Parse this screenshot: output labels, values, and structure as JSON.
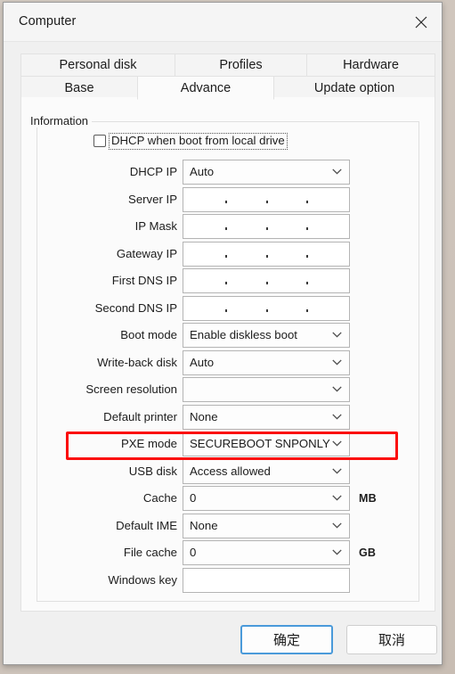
{
  "window": {
    "title": "Computer",
    "close_icon": "close-icon"
  },
  "tabs": {
    "row1": [
      {
        "label": "Personal disk",
        "selected": false
      },
      {
        "label": "Profiles",
        "selected": false
      },
      {
        "label": "Hardware",
        "selected": false
      }
    ],
    "row2": [
      {
        "label": "Base",
        "selected": false
      },
      {
        "label": "Advance",
        "selected": true
      },
      {
        "label": "Update option",
        "selected": false
      }
    ]
  },
  "group": {
    "legend": "Information"
  },
  "checkbox": {
    "label": "DHCP when boot from local drive",
    "checked": false
  },
  "fields": [
    {
      "label": "DHCP IP",
      "type": "combo",
      "value": "Auto",
      "unit": ""
    },
    {
      "label": "Server IP",
      "type": "ip",
      "value": "",
      "unit": ""
    },
    {
      "label": "IP Mask",
      "type": "ip",
      "value": "",
      "unit": ""
    },
    {
      "label": "Gateway IP",
      "type": "ip",
      "value": "",
      "unit": ""
    },
    {
      "label": "First DNS IP",
      "type": "ip",
      "value": "",
      "unit": ""
    },
    {
      "label": "Second DNS IP",
      "type": "ip",
      "value": "",
      "unit": ""
    },
    {
      "label": "Boot mode",
      "type": "combo",
      "value": "Enable diskless boot",
      "unit": ""
    },
    {
      "label": "Write-back disk",
      "type": "combo",
      "value": "Auto",
      "unit": ""
    },
    {
      "label": "Screen resolution",
      "type": "combo",
      "value": "",
      "unit": ""
    },
    {
      "label": "Default printer",
      "type": "combo",
      "value": "None",
      "unit": ""
    },
    {
      "label": "PXE mode",
      "type": "combo",
      "value": "SECUREBOOT SNPONLY",
      "unit": "",
      "highlighted": true
    },
    {
      "label": "USB disk",
      "type": "combo",
      "value": "Access allowed",
      "unit": ""
    },
    {
      "label": "Cache",
      "type": "combo",
      "value": "0",
      "unit": "MB"
    },
    {
      "label": "Default IME",
      "type": "combo",
      "value": "None",
      "unit": ""
    },
    {
      "label": "File cache",
      "type": "combo",
      "value": "0",
      "unit": "GB"
    },
    {
      "label": "Windows key",
      "type": "text",
      "value": "",
      "unit": ""
    }
  ],
  "footer": {
    "ok_label": "确定",
    "cancel_label": "取消"
  },
  "colors": {
    "highlight": "#fb0d0d",
    "focus_border": "#4a9ada",
    "dialog_bg": "#f0f0f0",
    "page_bg": "#fbfbfb"
  }
}
